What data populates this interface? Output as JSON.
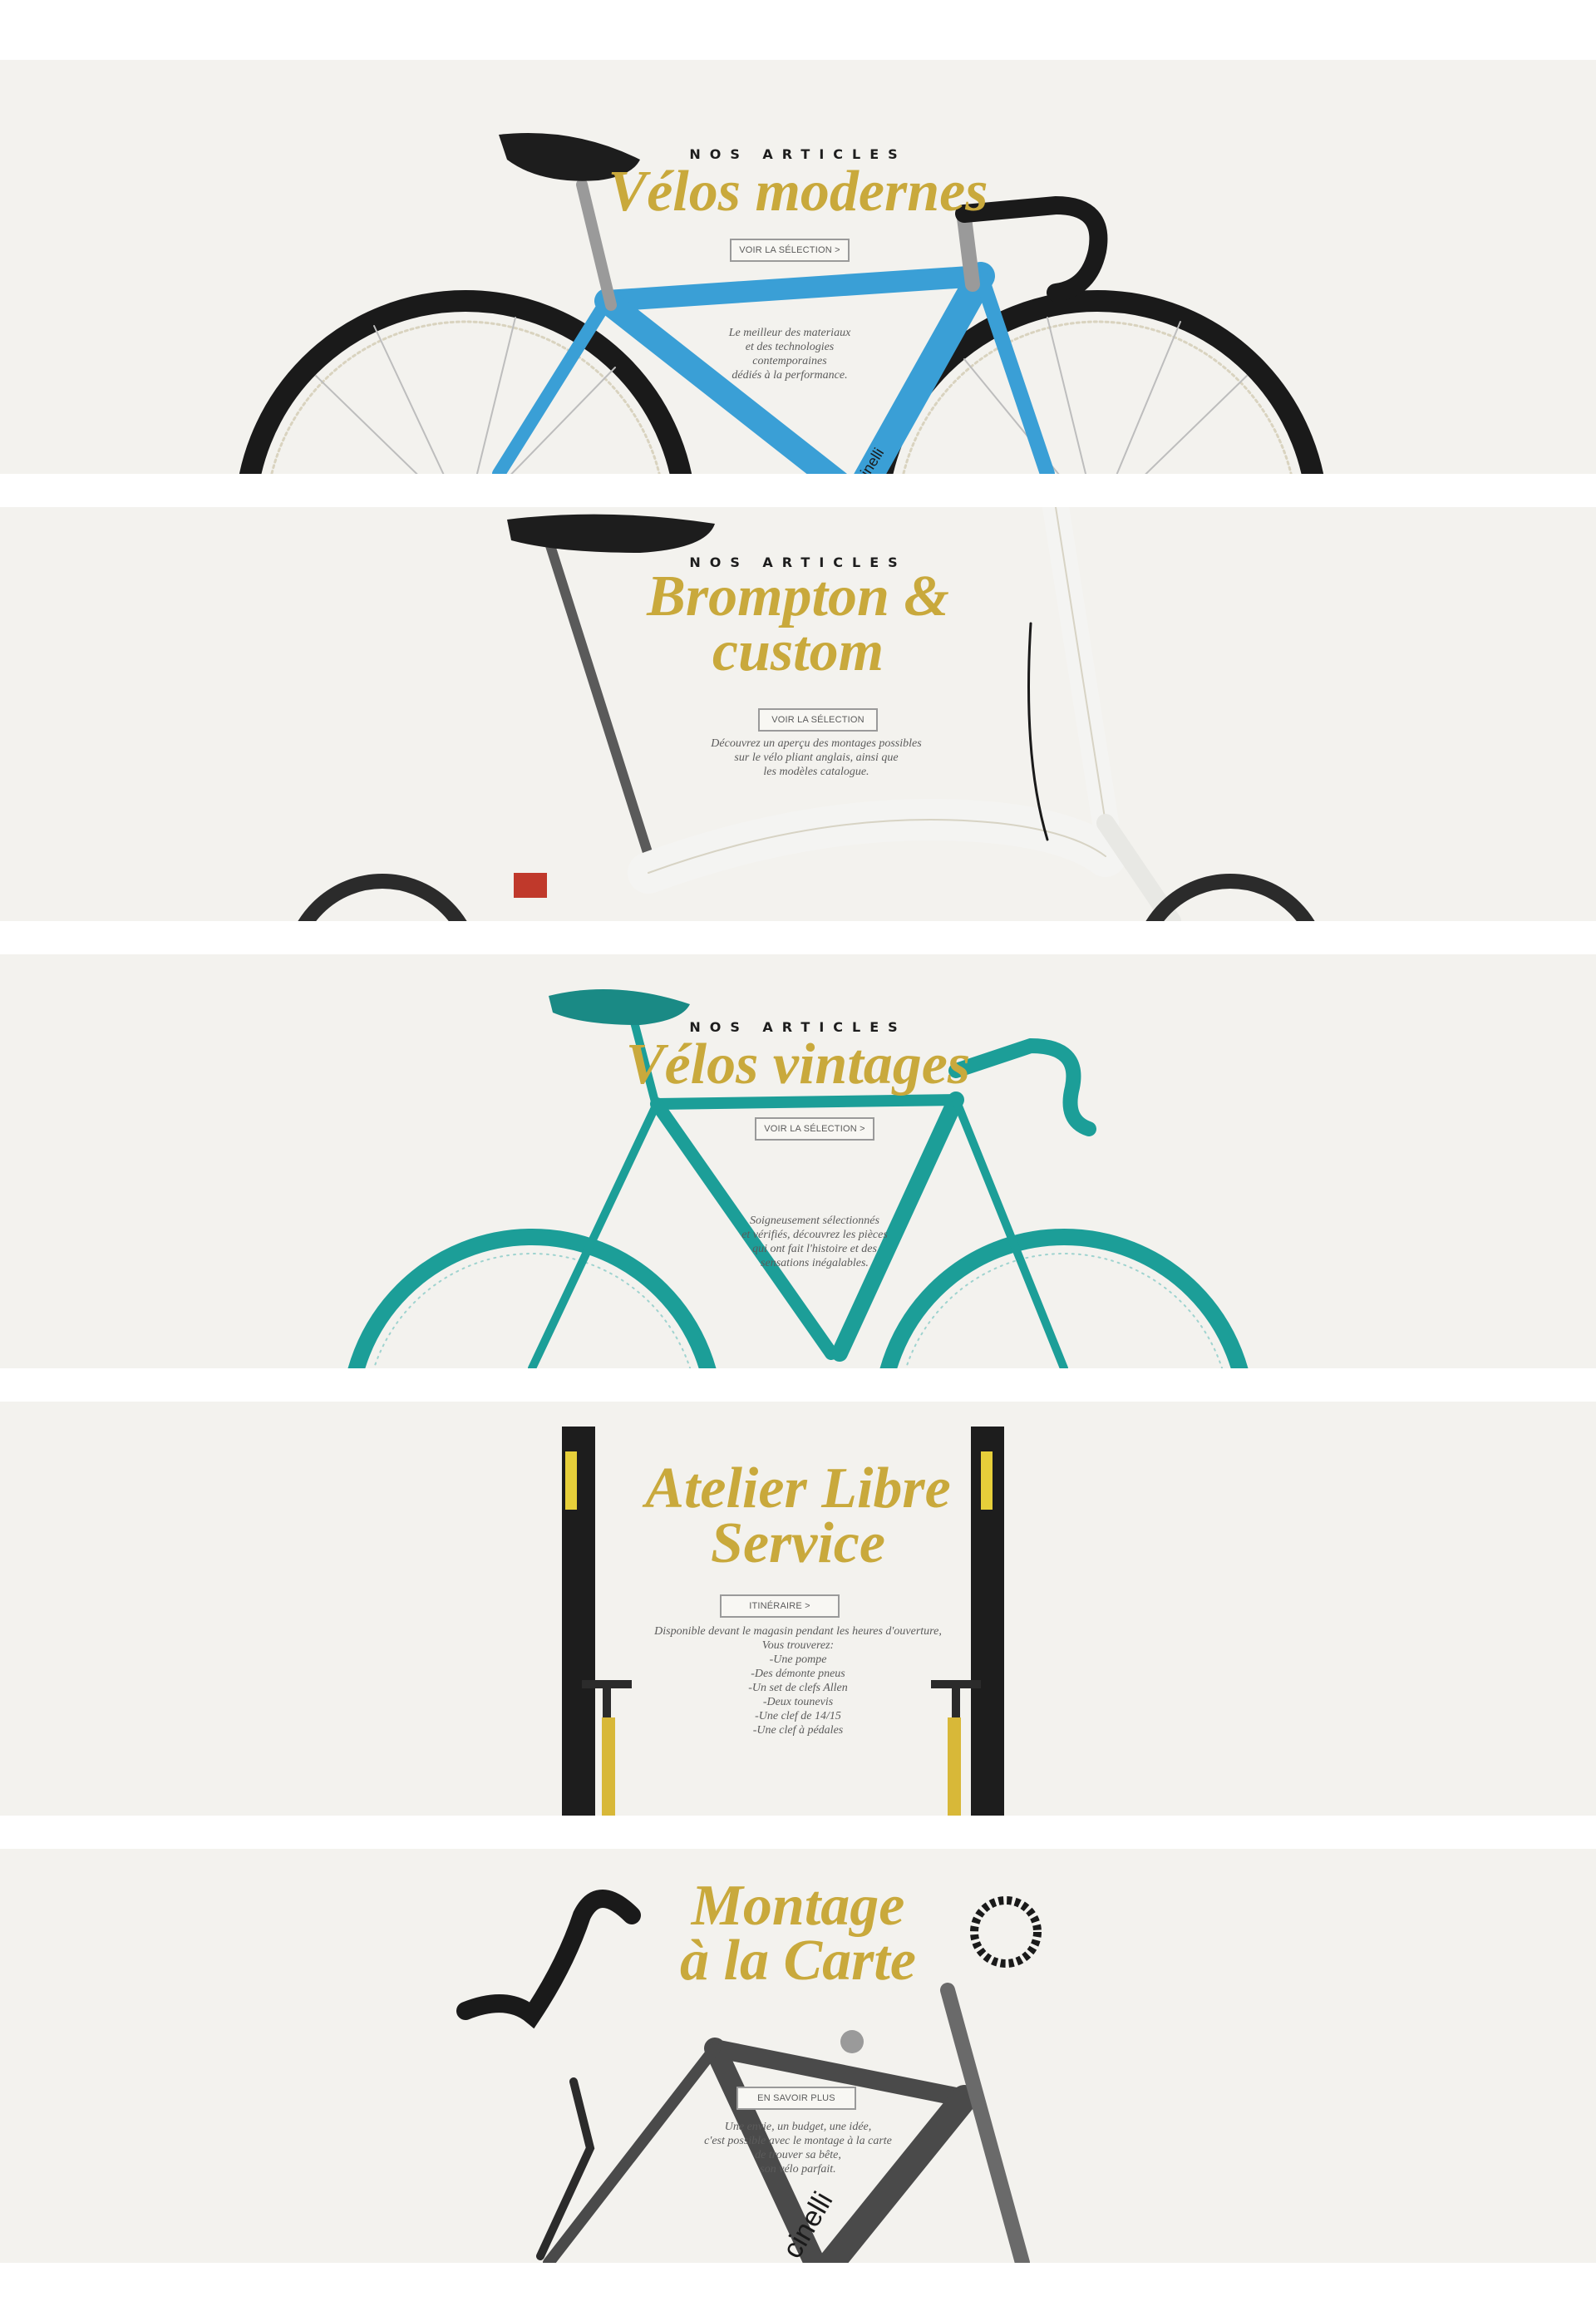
{
  "panels": [
    {
      "kicker": "NOS ARTICLES",
      "title": [
        "Vélos modernes"
      ],
      "button": "VOIR LA SÉLECTION >",
      "description": [
        "Le meilleur des materiaux",
        "et des technologies",
        "contemporaines",
        "dédiés à la performance."
      ],
      "bike_color": "#3a9fd6"
    },
    {
      "kicker": "NOS ARTICLES",
      "title": [
        "Brompton &",
        "custom"
      ],
      "button": "VOIR LA SÉLECTION",
      "description": [
        "Découvrez un aperçu des montages possibles",
        "sur le vélo pliant anglais, ainsi que",
        "les modèles catalogue."
      ],
      "bike_color": "#f4f4f2"
    },
    {
      "kicker": "NOS ARTICLES",
      "title": [
        "Vélos vintages"
      ],
      "button": "VOIR LA SÉLECTION >",
      "description": [
        "Soigneusement sélectionnés",
        "et vérifiés, découvrez les pièces",
        "qui ont fait l'histoire et des",
        "sensations inégalables."
      ],
      "bike_color": "#1c9e98"
    },
    {
      "kicker": "",
      "title": [
        "Atelier Libre",
        "Service"
      ],
      "button": "ITINÉRAIRE >",
      "description": [
        "Disponible devant le magasin pendant les heures d'ouverture,",
        "Vous trouverez:",
        "-Une pompe",
        "-Des démonte pneus",
        "-Un set de clefs Allen",
        "-Deux tounevis",
        "-Une clef de 14/15",
        "-Une clef à pédales"
      ]
    },
    {
      "kicker": "",
      "title": [
        "Montage",
        "à la Carte"
      ],
      "button": "EN SAVOIR PLUS",
      "description": [
        "Une envie, un budget, une idée,",
        "c'est possible avec le montage à la carte",
        "de trouver sa bête,",
        "son vélo parfait."
      ]
    }
  ],
  "colors": {
    "panel_bg": "#f3f2ee",
    "title_gold": "#c9a93c",
    "text_gray": "#5b5b5b",
    "modern_blue": "#3a9fd6",
    "vintage_teal": "#1c9e98",
    "tire_black": "#1a1a1a"
  },
  "icons": [
    "modern-bike-illustration",
    "brompton-bike-illustration",
    "vintage-bike-illustration",
    "pump-stands-illustration",
    "bike-parts-illustration"
  ]
}
